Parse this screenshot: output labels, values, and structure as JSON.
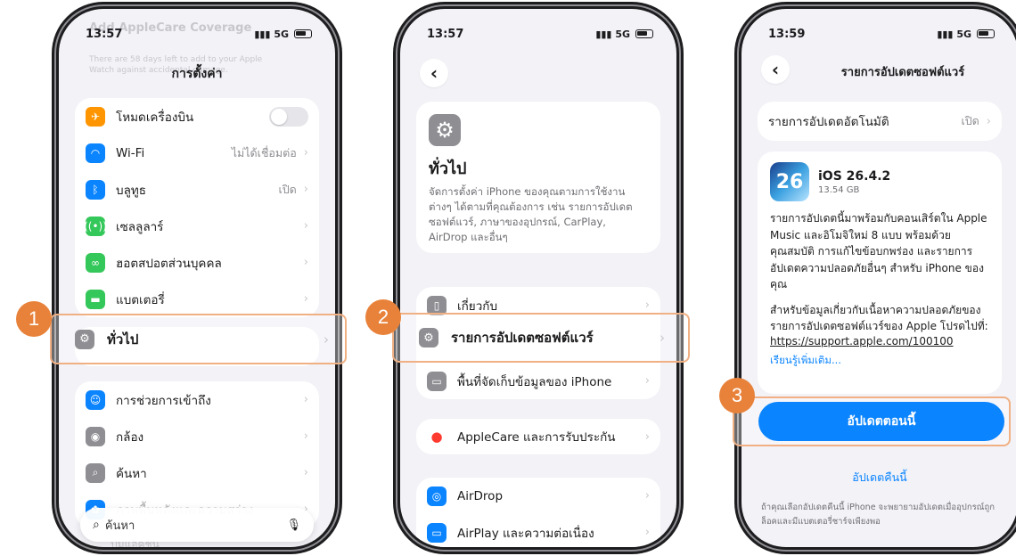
{
  "phone1": {
    "status": {
      "time": "13:57",
      "signal": "5G"
    },
    "bg_faded_title": "Add AppleCare Coverage",
    "bg_faded_sub1": "There are 58 days left to add to your Apple",
    "bg_faded_sub2": "Watch against accidental damage.",
    "title": "การตั้งค่า",
    "group1": [
      {
        "label": "โหมดเครื่องบิน",
        "value": "",
        "icon": "airplane-icon",
        "color": "#ff9500"
      },
      {
        "label": "Wi-Fi",
        "value": "ไม่ได้เชื่อมต่อ",
        "icon": "wifi-icon",
        "color": "#0a84ff"
      },
      {
        "label": "บลูทูธ",
        "value": "เปิด",
        "icon": "bluetooth-icon",
        "color": "#0a84ff"
      },
      {
        "label": "เซลลูลาร์",
        "value": "",
        "icon": "cellular-icon",
        "color": "#34c759"
      },
      {
        "label": "ฮอตสปอตส่วนบุคคล",
        "value": "",
        "icon": "hotspot-icon",
        "color": "#34c759"
      },
      {
        "label": "แบตเตอรี่",
        "value": "",
        "icon": "battery-icon",
        "color": "#34c759"
      }
    ],
    "general_label": "ทั่วไป",
    "group2": [
      {
        "label": "การช่วยการเข้าถึง",
        "icon": "accessibility-icon",
        "color": "#0a84ff"
      },
      {
        "label": "กล้อง",
        "icon": "camera-icon",
        "color": "#8e8e93"
      },
      {
        "label": "ค้นหา",
        "icon": "search-icon",
        "color": "#8e8e93"
      },
      {
        "label": "ภาพพื้นหลังและความสว่าง",
        "icon": "wallpaper-icon",
        "color": "#0a84ff"
      }
    ],
    "search_placeholder": "ค้นหา",
    "faded_bottom": "ปุ่มแอ็คชัน",
    "step": "1"
  },
  "phone2": {
    "status": {
      "time": "13:57",
      "signal": "5G"
    },
    "header_title": "ทั่วไป",
    "header_desc": "จัดการตั้งค่า iPhone ของคุณตามการใช้งานต่างๆ ได้ตามที่คุณต้องการ เช่น รายการอัปเดตซอฟต์แวร์, ภาษาของอุปกรณ์, CarPlay, AirDrop และอื่นๆ",
    "about": "เกี่ยวกับ",
    "software_update": "รายการอัปเดตซอฟต์แวร์",
    "storage": "พื้นที่จัดเก็บข้อมูลของ iPhone",
    "applecare": "AppleCare และการรับประกัน",
    "airdrop": "AirDrop",
    "airplay": "AirPlay และความต่อเนื่อง",
    "step": "2"
  },
  "phone3": {
    "status": {
      "time": "13:59",
      "signal": "5G"
    },
    "title": "รายการอัปเดตซอฟต์แวร์",
    "auto_update": "รายการอัปเดตอัตโนมัติ",
    "auto_update_value": "เปิด",
    "ios_icon_text": "26",
    "ios_name": "iOS 26.4.2",
    "ios_size": "13.54 GB",
    "desc1": "รายการอัปเดตนี้มาพร้อมกับคอนเสิร์ตใน Apple Music และอิโมจิใหม่ 8 แบบ พร้อมด้วยคุณสมบัติ การแก้ไขข้อบกพร่อง และรายการอัปเดตความปลอดภัยอื่นๆ สำหรับ iPhone ของคุณ",
    "desc2": "สำหรับข้อมูลเกี่ยวกับเนื้อหาความปลอดภัยของรายการอัปเดตซอฟต์แวร์ของ Apple โปรดไปที่:",
    "link": "https://support.apple.com/100100",
    "learn_more": "เรียนรู้เพิ่มเติม...",
    "update_now": "อัปเดตตอนนี้",
    "update_tonight": "อัปเดตคืนนี้",
    "footnote": "ถ้าคุณเลือกอัปเดตคืนนี้ iPhone จะพยายามอัปเดตเมื่ออุปกรณ์ถูกล็อคและมีแบตเตอรี่ชาร์จเพียงพอ",
    "step": "3"
  }
}
